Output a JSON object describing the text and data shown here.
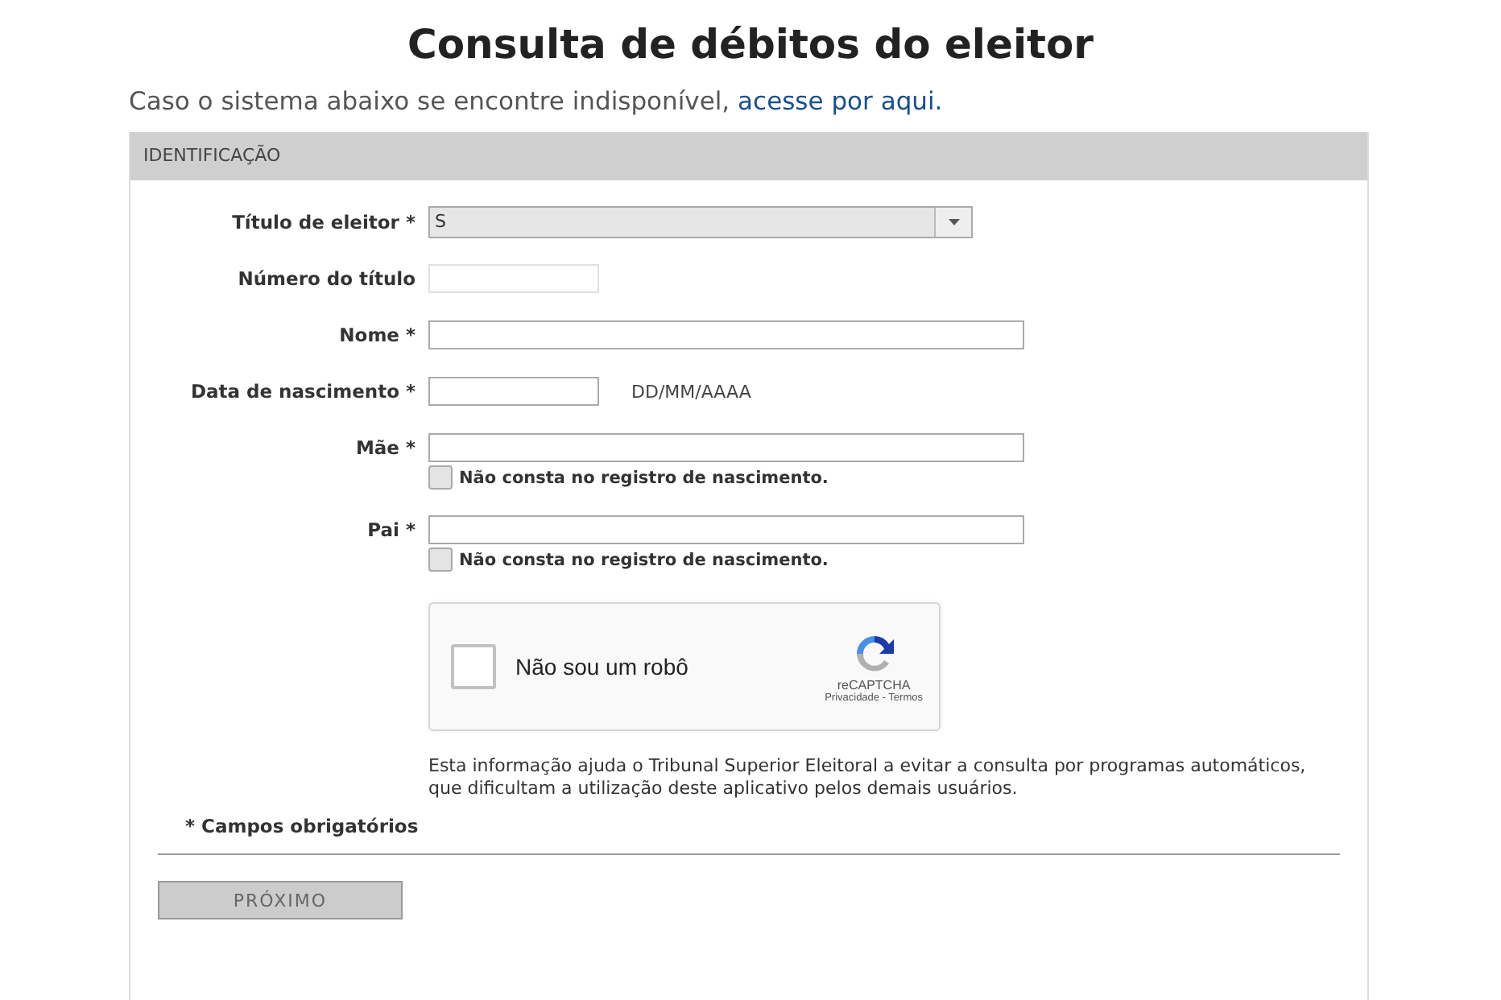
{
  "title": "Consulta de débitos do eleitor",
  "notice": {
    "text": "Caso o sistema abaixo se encontre indisponível, ",
    "link": "acesse por aqui."
  },
  "panel": {
    "header": "IDENTIFICAÇÃO",
    "fields": [
      {
        "kind": "select",
        "label": "Título de eleitor *",
        "value": "S"
      },
      {
        "kind": "short",
        "label": "Número do título"
      },
      {
        "kind": "long",
        "label": "Nome *"
      },
      {
        "kind": "date",
        "label": "Data de nascimento *",
        "format_hint": "DD/MM/AAAA"
      },
      {
        "kind": "long",
        "label": "Mãe *",
        "option": {
          "label": "Não consta no registro de nascimento.",
          "checked": false
        }
      },
      {
        "kind": "long",
        "label": "Pai *",
        "option": {
          "label": "Não consta no registro de nascimento.",
          "checked": false
        }
      }
    ],
    "captcha": {
      "label": "Não sou um robô",
      "checked": false,
      "brand": "reCAPTCHA",
      "links": "Privacidade - Termos"
    },
    "info": "Esta informação ajuda o Tribunal Superior Eleitoral a evitar a consulta por programas automáticos, que dificultam a utilização deste aplicativo pelos demais usuários.",
    "required_note": "* Campos obrigatórios",
    "next_button": "PRÓXIMO"
  }
}
